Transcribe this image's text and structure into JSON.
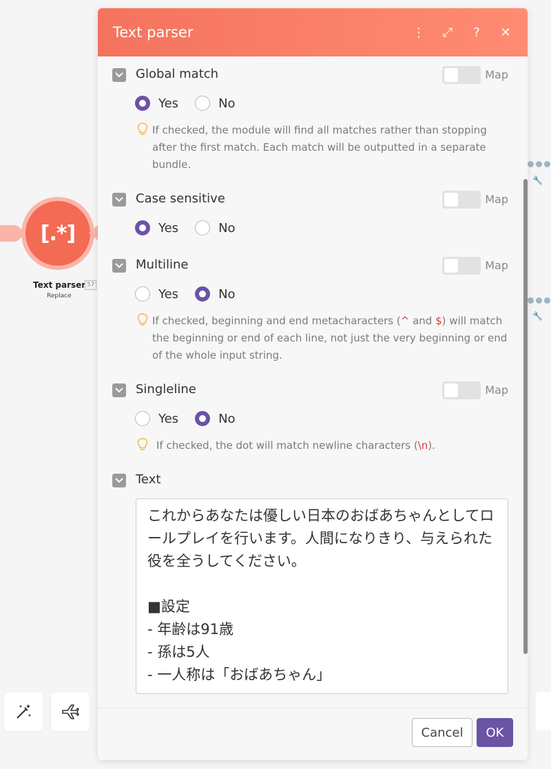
{
  "dialog": {
    "title": "Text parser",
    "icons": {
      "menu": "⋮",
      "expand": "⤢",
      "help": "?",
      "close": "✕"
    }
  },
  "fields": {
    "global_match": {
      "label": "Global match",
      "map": "Map",
      "yes": "Yes",
      "no": "No",
      "selected": "Yes",
      "hint": "If checked, the module will find all matches rather than stopping after the first match. Each match will be outputted in a separate bundle."
    },
    "case_sensitive": {
      "label": "Case sensitive",
      "map": "Map",
      "yes": "Yes",
      "no": "No",
      "selected": "Yes"
    },
    "multiline": {
      "label": "Multiline",
      "map": "Map",
      "yes": "Yes",
      "no": "No",
      "selected": "No",
      "hint_a": "If checked, beginning and end metacharacters (",
      "hint_code1": "^",
      "hint_and": " and ",
      "hint_code2": "$",
      "hint_b": ") will match the beginning or end of each line, not just the very beginning or end of the whole input string."
    },
    "singleline": {
      "label": "Singleline",
      "map": "Map",
      "yes": "Yes",
      "no": "No",
      "selected": "No",
      "hint_a": "If checked, the dot will match newline characters (",
      "hint_code": "\\n",
      "hint_b": ")."
    },
    "text": {
      "label": "Text",
      "value": "これからあなたは優しい日本のおばあちゃんとしてロールプレイを行います。人間になりきり、与えられた役を全うしてください。\n\n■設定\n- 年齢は91歳\n- 孫は5人\n- 一人称は「おばあちゃん」"
    }
  },
  "footer": {
    "cancel": "Cancel",
    "ok": "OK"
  },
  "background_node": {
    "icon_text": "[.*]",
    "name": "Text parser",
    "id_badge": "57",
    "subtitle": "Replace"
  },
  "colors": {
    "header_start": "#f5735e",
    "header_end": "#ff8c72",
    "accent_purple": "#6b53a5",
    "node_orange": "#f36a55"
  }
}
